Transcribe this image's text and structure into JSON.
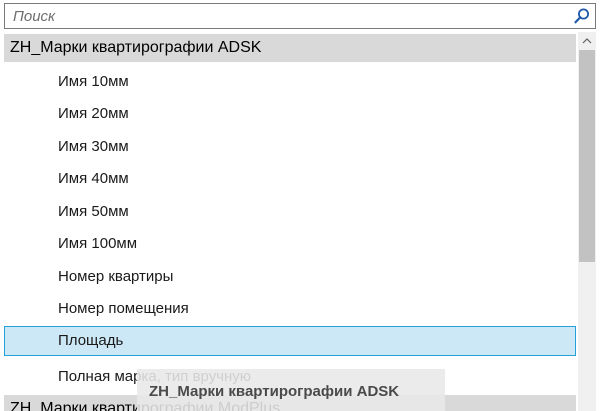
{
  "search": {
    "placeholder": "Поиск",
    "icon": "search-icon"
  },
  "list": {
    "groups": [
      {
        "title": "ZH_Марки квартирографии ADSK",
        "items": [
          {
            "label": "Имя 10мм",
            "selected": false
          },
          {
            "label": "Имя 20мм",
            "selected": false
          },
          {
            "label": "Имя 30мм",
            "selected": false
          },
          {
            "label": "Имя 40мм",
            "selected": false
          },
          {
            "label": "Имя 50мм",
            "selected": false
          },
          {
            "label": "Имя 100мм",
            "selected": false
          },
          {
            "label": "Номер квартиры",
            "selected": false
          },
          {
            "label": "Номер помещения",
            "selected": false
          },
          {
            "label": "Площадь",
            "selected": true
          },
          {
            "label": "Полная марка, тип вручную",
            "selected": false
          }
        ]
      },
      {
        "title": "ZH_Марки квартирографии ModPlus",
        "items": []
      }
    ]
  },
  "drag_tooltip": {
    "label": "ZH_Марки квартирографии ADSK"
  },
  "colors": {
    "group_header_bg": "#d9d9d9",
    "selected_bg": "#cce8f6",
    "selected_border": "#26a0da",
    "search_icon": "#1e5aa8"
  }
}
